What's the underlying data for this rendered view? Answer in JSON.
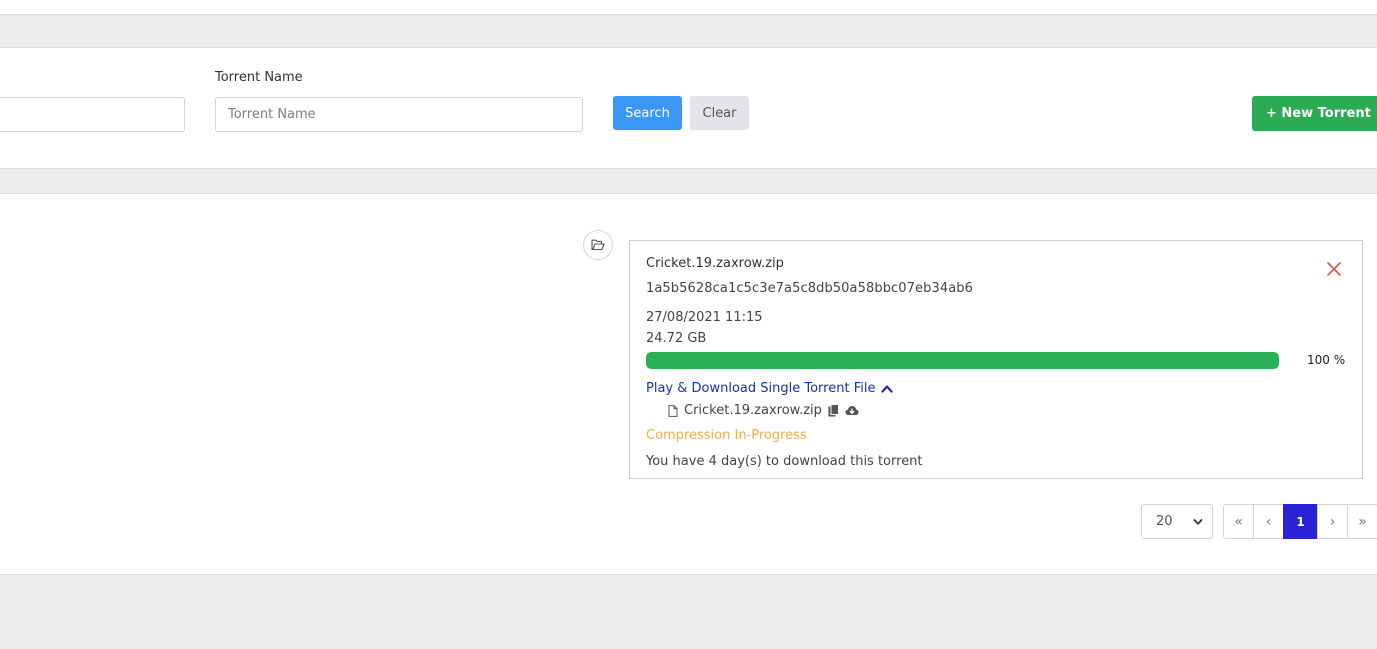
{
  "filters": {
    "torrent_name_label": "Torrent Name",
    "torrent_name_placeholder": "Torrent Name",
    "search_label": "Search",
    "clear_label": "Clear",
    "new_torrent_label": "+ New Torrent"
  },
  "torrent": {
    "name": "Cricket.19.zaxrow.zip",
    "hash": "1a5b5628ca1c5c3e7a5c8db50a58bbc07eb34ab6",
    "date": "27/08/2021 11:15",
    "size": "24.72 GB",
    "progress_percent": 100,
    "progress_label": "100 %",
    "play_link_label": "Play & Download Single Torrent File",
    "files": [
      {
        "name": "Cricket.19.zaxrow.zip"
      }
    ],
    "status": "Compression In-Progress",
    "expiry_text": "You have 4 day(s) to download this torrent"
  },
  "pagination": {
    "per_page": "20",
    "first": "«",
    "prev": "‹",
    "current": "1",
    "next": "›",
    "last": "»"
  },
  "colors": {
    "primary": "#3b97f7",
    "success": "#2bab53",
    "warning": "#f0ad4e",
    "danger": "#d9534f",
    "link": "#1b2fb0",
    "active_page": "#2a22d6"
  },
  "icons": {
    "folder": "folder-open-icon",
    "close": "close-icon",
    "chevron_up": "chevron-up-icon",
    "file": "file-icon",
    "copy": "copy-icon",
    "download": "cloud-download-icon"
  }
}
